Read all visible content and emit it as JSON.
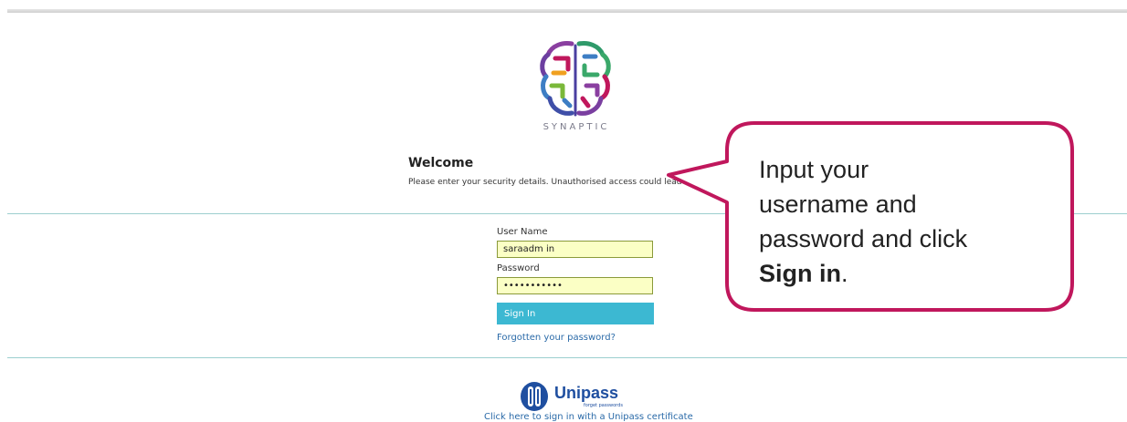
{
  "brand": {
    "logo_text": "SYNAPTIC"
  },
  "welcome": {
    "title": "Welcome",
    "description": "Please enter your security details. Unauthorised access could lead"
  },
  "login": {
    "username_label": "User Name",
    "username_value": "saraadm in",
    "password_label": "Password",
    "password_value": "•••••••••••",
    "signin_label": "Sign In",
    "forgot_label": "Forgotten your password?"
  },
  "unipass": {
    "logo_text": "Unipass",
    "logo_subtext": "forget passwords",
    "link_label": "Click here to sign in with a Unipass certificate"
  },
  "callout": {
    "text_lines": [
      "Input your",
      "username and",
      "password and click"
    ],
    "bold_text": "Sign in",
    "trailing_text": "."
  },
  "colors": {
    "accent": "#3cb8d2",
    "input_bg": "#fbffc5",
    "callout_border": "#c0175c",
    "divider": "#9ccfcf",
    "link": "#2a6aa8"
  }
}
